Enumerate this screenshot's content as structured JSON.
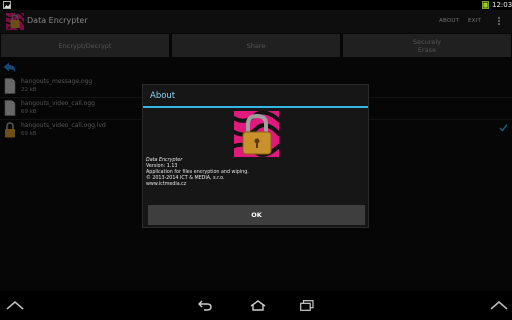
{
  "status": {
    "time": "12:03"
  },
  "app": {
    "title": "Data Encrypter"
  },
  "actionbar": {
    "about": "ABOUT",
    "exit": "EXIT"
  },
  "tabs": [
    {
      "label": "Encrypt/Decrypt"
    },
    {
      "label": "Share"
    },
    {
      "label_line1": "Securely",
      "label_line2": "Erase"
    }
  ],
  "files": [
    {
      "name": "hangouts_message.ogg",
      "size": "22 kB",
      "type": "file",
      "checked": false
    },
    {
      "name": "hangouts_video_call.ogg",
      "size": "69 kB",
      "type": "file",
      "checked": false
    },
    {
      "name": "hangouts_video_call.ogg.lvd",
      "size": "69 kB",
      "type": "encrypted",
      "checked": true
    }
  ],
  "dialog": {
    "title": "About",
    "lines": [
      "Data Encrypter",
      "Version: 1.13",
      "Application for files encryption and wiping.",
      "© 2013-2014 ICT & MEDIA, s.r.o.",
      "www.ictmedia.cz"
    ],
    "ok": "OK"
  },
  "colors": {
    "accent": "#33b5e5",
    "brand": "#e0197d",
    "tab_bg": "#3b3b3b"
  }
}
